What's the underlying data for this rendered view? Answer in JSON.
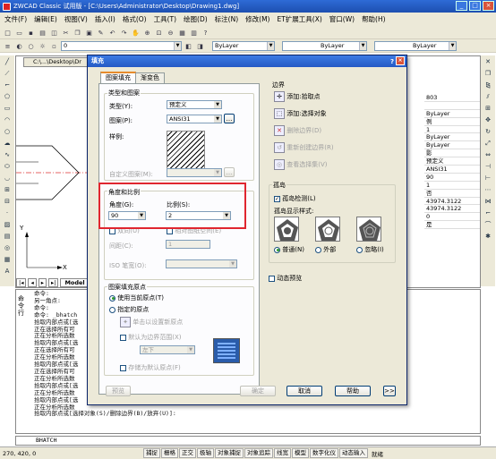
{
  "window": {
    "title": "ZWCAD Classic 试用版 - [C:\\Users\\Administrator\\Desktop\\Drawing1.dwg]",
    "min": "_",
    "max": "□",
    "close": "×"
  },
  "menu": [
    "文件(F)",
    "编辑(E)",
    "视图(V)",
    "插入(I)",
    "格式(O)",
    "工具(T)",
    "绘图(D)",
    "标注(N)",
    "修改(M)",
    "ET扩展工具(X)",
    "窗口(W)",
    "帮助(H)"
  ],
  "toolbar": {
    "layer": "0",
    "color": "ByLayer",
    "linetype": "ByLayer",
    "lineweight": "ByLayer"
  },
  "doc_tab": "C:\\...\\Desktop\\Dr",
  "drawing": {
    "model_tab": "Model",
    "axis_x": "X",
    "axis_y": "Y"
  },
  "properties": [
    "803",
    "",
    "ByLayer",
    "例",
    "1",
    "ByLayer",
    "ByLayer",
    "影",
    "预定义",
    "ANSI31",
    "90",
    "1",
    "否",
    "43974.3122",
    "43974.3122",
    "0",
    "是"
  ],
  "command": {
    "side_label": "命令行",
    "lines": [
      "命令:",
      "另一角点:",
      "命令:",
      "命令: _bhatch",
      "拾取内部点或[选",
      "正在选择所有可",
      "正在分析所选数",
      "拾取内部点或[选",
      "正在选择所有可",
      "正在分析所选数",
      "拾取内部点或[选",
      "正在选择所有可",
      "正在分析所选数",
      "拾取内部点或[选",
      "正在分析所选数",
      "拾取内部点或[选",
      "正在分析所选数",
      "拾取内部点或[选择对象(S)/删除边界(B)/放弃(U)]:"
    ],
    "input": "BHATCH"
  },
  "status": {
    "coords": "270, 420, 0",
    "buttons": [
      "捕捉",
      "栅格",
      "正交",
      "极轴",
      "对象捕捉",
      "对象追踪",
      "线宽",
      "模型",
      "数字化仪",
      "动态输入",
      "就绪"
    ]
  },
  "dialog": {
    "title": "填充",
    "help": "?",
    "close": "×",
    "tabs": [
      "图案填充",
      "渐变色"
    ],
    "type_pattern": {
      "group": "类型和图案",
      "type_label": "类型(Y):",
      "type_value": "预定义",
      "pattern_label": "图案(P):",
      "pattern_value": "ANSI31",
      "swatch_label": "样例:",
      "custom_label": "自定义图案(M):"
    },
    "angle_scale": {
      "group": "角度和比例",
      "angle_label": "角度(G):",
      "angle_value": "90",
      "scale_label": "比例(S):",
      "scale_value": "2",
      "double_label": "双向(U)",
      "relative_label": "相对图纸空间(E)",
      "spacing_label": "间距(C):",
      "spacing_value": "1",
      "iso_label": "ISO 笔宽(O):"
    },
    "origin": {
      "group": "图案填充原点",
      "current": "使用当前原点(T)",
      "specified": "指定的原点",
      "click_set": "单击以设置新原点",
      "default_extent": "默认为边界范围(X)",
      "extent_value": "左下",
      "store": "存储为默认原点(F)"
    },
    "boundary": {
      "group": "边界",
      "add_pick": "添加:拾取点",
      "add_select": "添加:选择对象",
      "remove": "删除边界(D)",
      "recreate": "重新创建边界(R)",
      "view": "查看选择集(V)"
    },
    "islands": {
      "group": "孤岛",
      "detect": "孤岛检测(L)",
      "style_label": "孤岛显示样式:",
      "normal": "普通(N)",
      "outer": "外部",
      "ignore": "忽略(I)"
    },
    "dynamic_preview": "动态预览",
    "buttons": {
      "preview": "预览",
      "ok": "确定",
      "cancel": "取消",
      "help": "帮助",
      "more": ">>"
    }
  }
}
